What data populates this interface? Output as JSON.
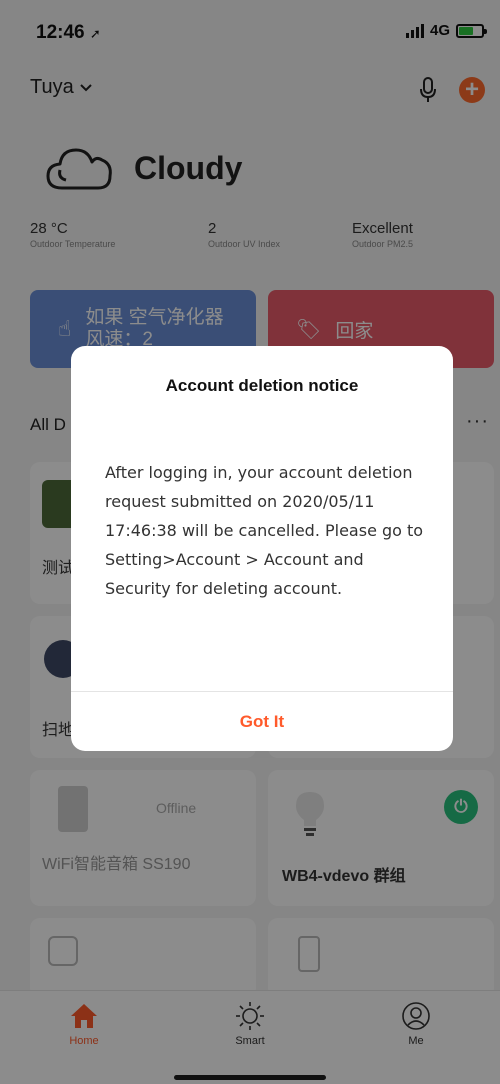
{
  "status": {
    "time": "12:46",
    "network": "4G"
  },
  "header": {
    "home_name": "Tuya"
  },
  "weather": {
    "title": "Cloudy",
    "stats": [
      {
        "value": "28 °C",
        "label": "Outdoor Temperature"
      },
      {
        "value": "2",
        "label": "Outdoor UV Index"
      },
      {
        "value": "Excellent",
        "label": "Outdoor PM2.5"
      }
    ]
  },
  "scenes": [
    {
      "label": "如果 空气净化器 风速：2"
    },
    {
      "label": "回家"
    }
  ],
  "devices_section": {
    "title": "All D"
  },
  "devices": [
    {
      "label": "测试"
    },
    {
      "label": "扫地"
    },
    {
      "label": "WiFi智能音箱 SS190",
      "status": "Offline"
    },
    {
      "label": "WB4-vdevo 群组"
    }
  ],
  "tabs": [
    {
      "label": "Home"
    },
    {
      "label": "Smart"
    },
    {
      "label": "Me"
    }
  ],
  "dialog": {
    "title": "Account deletion notice",
    "message": "After logging in, your account deletion request submitted on 2020/05/11 17:46:38 will be cancelled. Please go to Setting>Account > Account and Security for deleting account.",
    "button": "Got It"
  },
  "colors": {
    "accent": "#ff5a2b",
    "scene_a": "#6a8fd8",
    "scene_b": "#ea5b6b",
    "power_on": "#29c17e"
  }
}
